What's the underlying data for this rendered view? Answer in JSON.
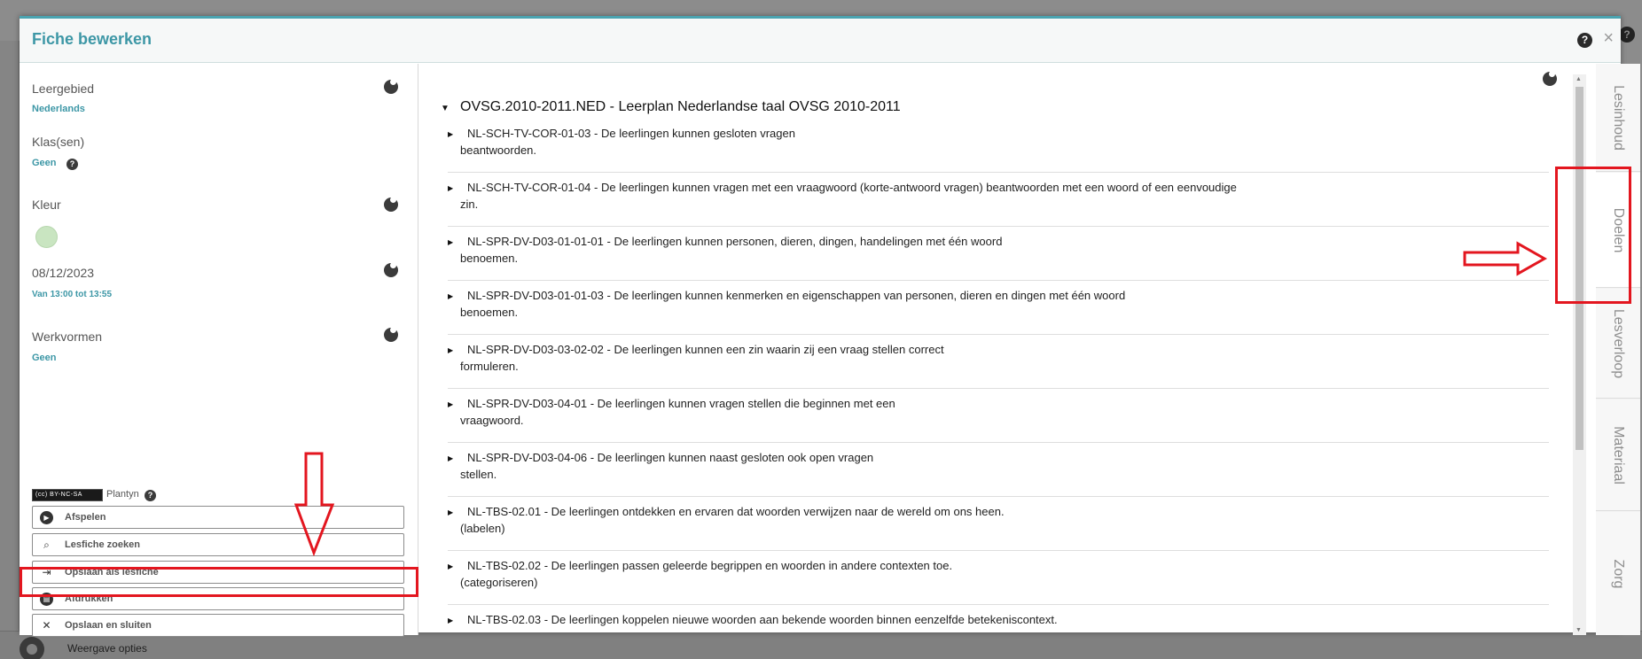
{
  "background": {
    "footer_label": "Weergave opties"
  },
  "modal": {
    "title": "Fiche bewerken",
    "help": "?",
    "close": "×"
  },
  "left_panel": {
    "leergebied": {
      "label": "Leergebied",
      "value": "Nederlands"
    },
    "klassen": {
      "label": "Klas(sen)",
      "value": "Geen"
    },
    "kleur": {
      "label": "Kleur",
      "value_color": "#c9e5c1"
    },
    "datum": {
      "label": "08/12/2023",
      "value": "Van 13:00 tot 13:55"
    },
    "werkvormen": {
      "label": "Werkvormen",
      "value": "Geen"
    },
    "license": {
      "badge": "(cc) BY-NC-SA",
      "owner": "Plantyn"
    },
    "actions": [
      {
        "label": "Afspelen",
        "icon": "play-icon"
      },
      {
        "label": "Lesfiche zoeken",
        "icon": "search-document-icon"
      },
      {
        "label": "Opslaan als lesfiche",
        "icon": "save-as-icon"
      },
      {
        "label": "Afdrukken",
        "icon": "print-icon"
      },
      {
        "label": "Opslaan en sluiten",
        "icon": "close-icon"
      }
    ]
  },
  "main": {
    "root": "OVSG.2010-2011.NED - Leerplan Nederlandse taal OVSG 2010-2011",
    "goals": [
      {
        "line1": "NL-SCH-TV-COR-01-03 - De leerlingen kunnen gesloten vragen",
        "line2": "beantwoorden."
      },
      {
        "line1": "NL-SCH-TV-COR-01-04 - De leerlingen kunnen vragen met een vraagwoord (korte-antwoord vragen) beantwoorden met een woord of een eenvoudige",
        "line2": "zin."
      },
      {
        "line1": "NL-SPR-DV-D03-01-01-01 - De leerlingen kunnen personen, dieren, dingen, handelingen met één woord",
        "line2": "benoemen."
      },
      {
        "line1": "NL-SPR-DV-D03-01-01-03 - De leerlingen kunnen kenmerken en eigenschappen van personen, dieren en dingen met één woord",
        "line2": "benoemen."
      },
      {
        "line1": "NL-SPR-DV-D03-03-02-02 - De leerlingen kunnen een zin waarin zij een vraag stellen correct",
        "line2": "formuleren."
      },
      {
        "line1": "NL-SPR-DV-D03-04-01 - De leerlingen kunnen vragen stellen die beginnen met een",
        "line2": "vraagwoord."
      },
      {
        "line1": "NL-SPR-DV-D03-04-06 - De leerlingen kunnen naast gesloten ook open vragen",
        "line2": "stellen."
      },
      {
        "line1": "NL-TBS-02.01 - De leerlingen ontdekken en ervaren dat woorden verwijzen naar de wereld om ons heen.",
        "line2": "(labelen)"
      },
      {
        "line1": "NL-TBS-02.02 - De leerlingen passen geleerde begrippen en woorden in andere contexten toe.",
        "line2": "(categoriseren)"
      },
      {
        "line1": "NL-TBS-02.03 - De leerlingen koppelen nieuwe woorden aan bekende woorden binnen eenzelfde betekeniscontext.",
        "line2": ""
      }
    ]
  },
  "tabs": [
    {
      "label": "Lesinhoud"
    },
    {
      "label": "Doelen"
    },
    {
      "label": "Lesverloop"
    },
    {
      "label": "Materiaal"
    },
    {
      "label": "Zorg"
    }
  ],
  "annotation_color": "#e3161f"
}
